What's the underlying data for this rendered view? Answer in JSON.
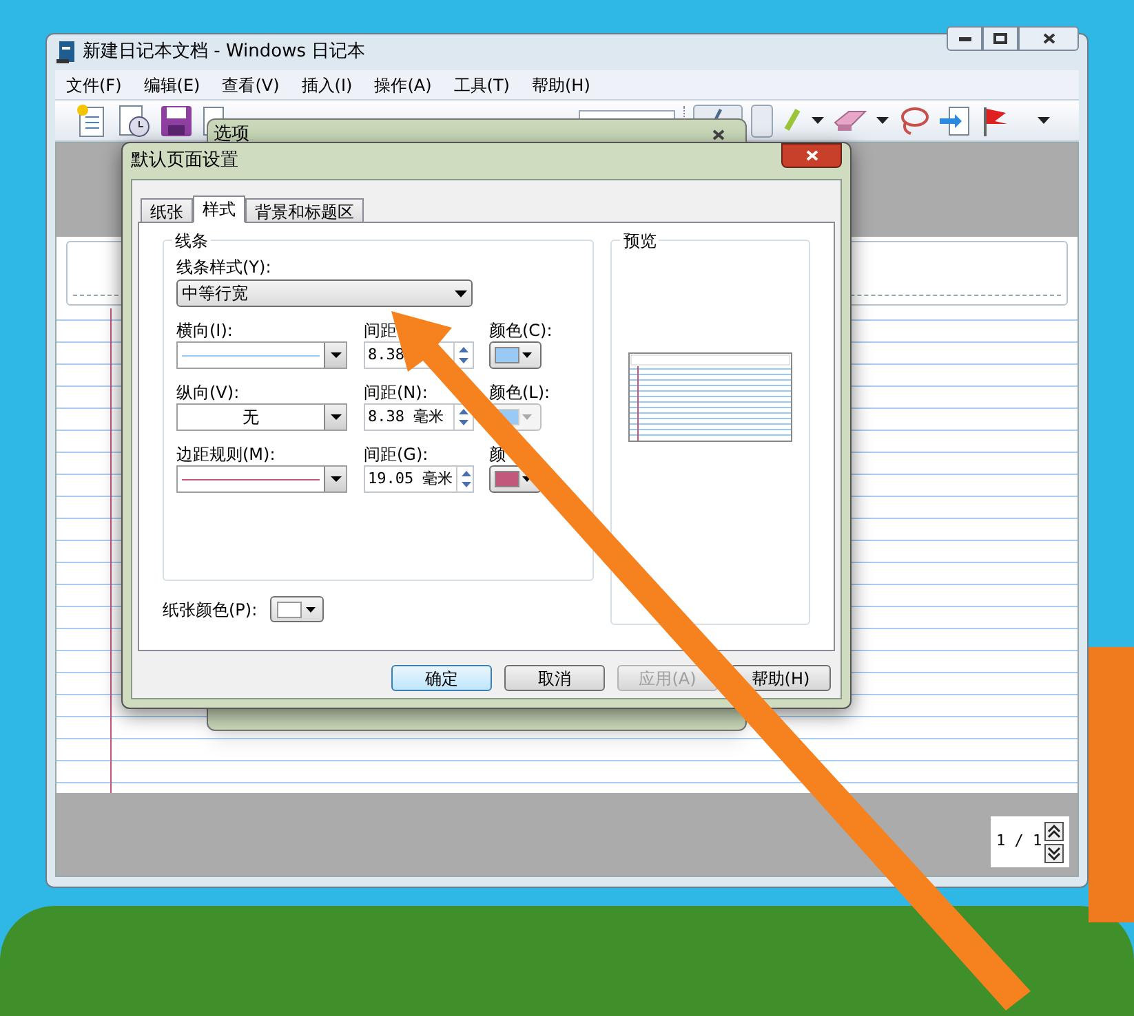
{
  "window": {
    "title": "新建日记本文档 - Windows 日记本"
  },
  "menu": [
    "文件(F)",
    "编辑(E)",
    "查看(V)",
    "插入(I)",
    "操作(A)",
    "工具(T)",
    "帮助(H)"
  ],
  "page_nav": {
    "text": "1 / 1"
  },
  "back_dialog": {
    "title": "选项"
  },
  "dialog": {
    "title": "默认页面设置",
    "tabs": [
      {
        "label": "纸张",
        "selected": false
      },
      {
        "label": "样式",
        "selected": true
      },
      {
        "label": "背景和标题区",
        "selected": false
      }
    ],
    "group_title": "线条",
    "line_style": {
      "label": "线条样式(Y):",
      "value": "中等行宽"
    },
    "rows": [
      {
        "label": "横向(I):",
        "style": {
          "kind": "line",
          "color": "#99c9f5"
        },
        "spacing_label": "间距",
        "spacing": "8.38",
        "color_label": "颜色(C):",
        "swatch": {
          "color": "#99c9f5",
          "disabled": false
        }
      },
      {
        "label": "纵向(V):",
        "style": {
          "kind": "text",
          "text": "无"
        },
        "spacing_label": "间距(N):",
        "spacing": "8.38 毫米",
        "color_label": "颜色(L):",
        "swatch": {
          "color": "#99c9f5",
          "disabled": true
        }
      },
      {
        "label": "边距规则(M):",
        "style": {
          "kind": "line",
          "color": "#c2557a"
        },
        "spacing_label": "间距(G):",
        "spacing": "19.05 毫米",
        "color_label": "颜",
        "swatch": {
          "color": "#c2587c",
          "disabled": false
        }
      }
    ],
    "paper_color": {
      "label": "纸张颜色(P):",
      "color": "#ffffff"
    },
    "preview_title": "预览",
    "buttons": [
      {
        "label": "确定",
        "default": true,
        "disabled": false
      },
      {
        "label": "取消",
        "default": false,
        "disabled": false
      },
      {
        "label": "应用(A)",
        "default": false,
        "disabled": true
      },
      {
        "label": "帮助(H)",
        "default": false,
        "disabled": false
      }
    ]
  }
}
